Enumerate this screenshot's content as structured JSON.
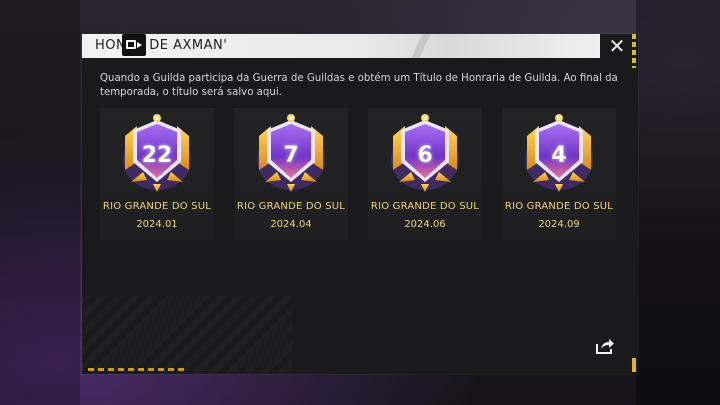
{
  "dialog": {
    "title": "HONRA DE AXMAN'",
    "close_label": "✕",
    "description": "Quando a Guilda participa da Guerra de Guildas e obtém um Título de Honraria de Guilda. Ao final da temporada, o título será salvo aqui."
  },
  "honors": [
    {
      "rank": "22",
      "region": "RIO GRANDE DO SUL",
      "season": "2024.01"
    },
    {
      "rank": "7",
      "region": "RIO GRANDE DO SUL",
      "season": "2024.04"
    },
    {
      "rank": "6",
      "region": "RIO GRANDE DO SUL",
      "season": "2024.06"
    },
    {
      "rank": "4",
      "region": "RIO GRANDE DO SUL",
      "season": "2024.09"
    }
  ],
  "colors": {
    "gold": "#e2b52a",
    "badge_purple": "#7a3fd0",
    "label_gold": "#f2d278"
  },
  "icons": {
    "share": "share-icon",
    "close": "close-icon",
    "record": "screen-record-icon"
  }
}
